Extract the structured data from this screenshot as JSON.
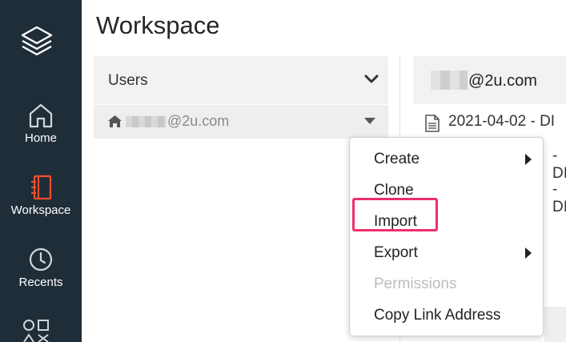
{
  "nav": {
    "items": [
      {
        "label": "Home",
        "icon": "home-icon"
      },
      {
        "label": "Workspace",
        "icon": "notebook-icon",
        "active": true,
        "accent": "#f24f2a"
      },
      {
        "label": "Recents",
        "icon": "clock-icon"
      }
    ],
    "logo_icon": "layers-icon",
    "bottom_icon": "shapes-icon"
  },
  "page": {
    "title": "Workspace"
  },
  "users": {
    "header": "Users",
    "user_email": "@2u.com"
  },
  "right": {
    "header_email": "@2u.com",
    "file_text": "2021-04-02 - DI",
    "row_fragment_1": "- DI",
    "row_fragment_2": "- DI"
  },
  "menu": {
    "items": [
      {
        "label": "Create",
        "has_submenu": true
      },
      {
        "label": "Clone"
      },
      {
        "label": "Import",
        "highlighted": true
      },
      {
        "label": "Export",
        "has_submenu": true
      },
      {
        "label": "Permissions",
        "disabled": true
      },
      {
        "label": "Copy Link Address"
      }
    ]
  },
  "colors": {
    "rail": "#1f2d38",
    "accent": "#f24f2a",
    "highlight": "#ee2f6a"
  }
}
